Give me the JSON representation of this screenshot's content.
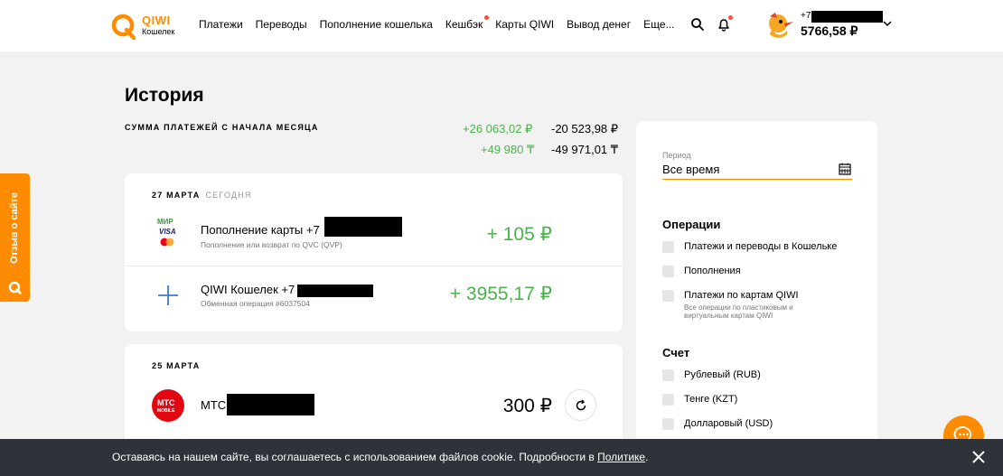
{
  "header": {
    "logo_text": "QIWI",
    "logo_sub": "Кошелек",
    "nav": [
      "Платежи",
      "Переводы",
      "Пополнение кошелька",
      "Кешбэк",
      "Карты QIWI",
      "Вывод денег",
      "Еще..."
    ],
    "account_prefix": "+7",
    "balance": "5766,58 ₽",
    "icons": [
      "search-icon",
      "bell-icon",
      "chevron-down-icon"
    ]
  },
  "page": {
    "title": "История",
    "sum_label": "СУММА ПЛАТЕЖЕЙ С НАЧАЛА МЕСЯЦА",
    "sums": {
      "rub_in": "+26 063,02 ₽",
      "rub_out": "-20 523,98 ₽",
      "kzt_in": "+49 980 ₸",
      "kzt_out": "-49 971,01 ₸"
    }
  },
  "groups": [
    {
      "date": "27 МАРТА",
      "today": "СЕГОДНЯ",
      "items": [
        {
          "title": "Пополнение карты +7",
          "subtitle": "Пополнение или возврат по QVC (QVP)",
          "amount": "+ 105 ₽",
          "icon": "card-brands-icon"
        },
        {
          "title": "QIWI Кошелек +7",
          "subtitle": "Обменная операция #6037504",
          "amount": "+ 3955,17 ₽",
          "icon": "plus-icon"
        }
      ]
    },
    {
      "date": "25 МАРТА",
      "items": [
        {
          "title": "МТС",
          "amount": "300 ₽",
          "icon": "mts-logo-icon"
        }
      ]
    }
  ],
  "filters": {
    "period_label": "Период",
    "period_value": "Все время",
    "operations_title": "Операции",
    "operations": [
      "Платежи и переводы в Кошельке",
      "Пополнения",
      "Платежи по картам QIWI"
    ],
    "operations_note": "Все операции по пластиковым и виртуальным картам QIWI",
    "account_title": "Счет",
    "accounts": [
      "Рублевый (RUB)",
      "Тенге (KZT)",
      "Долларовый (USD)"
    ]
  },
  "feedback": {
    "label": "Отзыв о сайте"
  },
  "cookie": {
    "text": "Оставаясь на нашем сайте, вы соглашаетесь с использованием файлов cookie. Подробности в ",
    "link": "Политике",
    "end": "."
  },
  "colors": {
    "accent": "#ff8c00",
    "income": "#4bb34b",
    "notify": "#ff4b3a",
    "cookie_bg": "#2d3338"
  }
}
